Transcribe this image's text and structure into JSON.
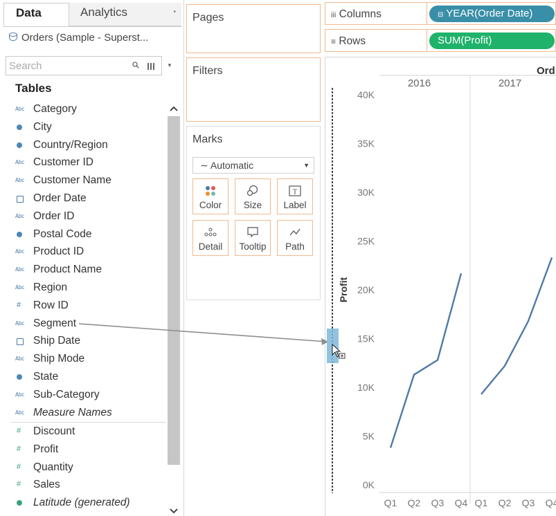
{
  "tabs": {
    "data": "Data",
    "analytics": "Analytics"
  },
  "datasource": "Orders (Sample - Superst...",
  "search": {
    "placeholder": "Search"
  },
  "tables_header": "Tables",
  "dimensions": [
    {
      "label": "Category",
      "icon": "abc",
      "italic": false
    },
    {
      "label": "City",
      "icon": "globe",
      "italic": false
    },
    {
      "label": "Country/Region",
      "icon": "globe",
      "italic": false
    },
    {
      "label": "Customer ID",
      "icon": "abc",
      "italic": false
    },
    {
      "label": "Customer Name",
      "icon": "abc",
      "italic": false
    },
    {
      "label": "Order Date",
      "icon": "calendar",
      "italic": false
    },
    {
      "label": "Order ID",
      "icon": "abc",
      "italic": false
    },
    {
      "label": "Postal Code",
      "icon": "globe",
      "italic": false
    },
    {
      "label": "Product ID",
      "icon": "abc",
      "italic": false
    },
    {
      "label": "Product Name",
      "icon": "abc",
      "italic": false
    },
    {
      "label": "Region",
      "icon": "abc",
      "italic": false
    },
    {
      "label": "Row ID",
      "icon": "hash",
      "italic": false
    },
    {
      "label": "Segment",
      "icon": "abc",
      "italic": false
    },
    {
      "label": "Ship Date",
      "icon": "calendar",
      "italic": false
    },
    {
      "label": "Ship Mode",
      "icon": "abc",
      "italic": false
    },
    {
      "label": "State",
      "icon": "globe",
      "italic": false
    },
    {
      "label": "Sub-Category",
      "icon": "abc",
      "italic": false
    },
    {
      "label": "Measure Names",
      "icon": "abc",
      "italic": true
    }
  ],
  "measures": [
    {
      "label": "Discount",
      "icon": "hash",
      "italic": false
    },
    {
      "label": "Profit",
      "icon": "hash",
      "italic": false
    },
    {
      "label": "Quantity",
      "icon": "hash",
      "italic": false
    },
    {
      "label": "Sales",
      "icon": "hash",
      "italic": false
    },
    {
      "label": "Latitude (generated)",
      "icon": "globe",
      "italic": true
    }
  ],
  "shelves": {
    "pages": "Pages",
    "filters": "Filters",
    "marks": "Marks",
    "columns": "Columns",
    "rows": "Rows",
    "columns_pill": "YEAR(Order Date)",
    "rows_pill": "SUM(Profit)"
  },
  "marks": {
    "type": "Automatic",
    "buttons": [
      {
        "label": "Color",
        "icon": "color-icon"
      },
      {
        "label": "Size",
        "icon": "size-icon"
      },
      {
        "label": "Label",
        "icon": "label-icon"
      },
      {
        "label": "Detail",
        "icon": "detail-icon"
      },
      {
        "label": "Tooltip",
        "icon": "tooltip-icon"
      },
      {
        "label": "Path",
        "icon": "path-icon"
      }
    ]
  },
  "colors": {
    "pill_dimension": "#3a8fa8",
    "pill_measure": "#1fb26b",
    "shelf_border": "#f0b98e",
    "line": "#4e79a7",
    "drop_target": "#7fb9d8"
  },
  "chart_data": {
    "type": "line",
    "title": "Ord",
    "ylabel": "Profit",
    "ylim": [
      0,
      40000
    ],
    "y_ticks": [
      "0K",
      "5K",
      "10K",
      "15K",
      "20K",
      "25K",
      "30K",
      "35K",
      "40K"
    ],
    "panes": [
      {
        "header": "2016",
        "categories": [
          "Q1",
          "Q2",
          "Q3",
          "Q4"
        ],
        "values": [
          3800,
          11300,
          12800,
          21700
        ]
      },
      {
        "header": "2017",
        "categories": [
          "Q1",
          "Q2",
          "Q3",
          "Q4"
        ],
        "values": [
          9300,
          12200,
          16800,
          23300
        ]
      }
    ]
  }
}
